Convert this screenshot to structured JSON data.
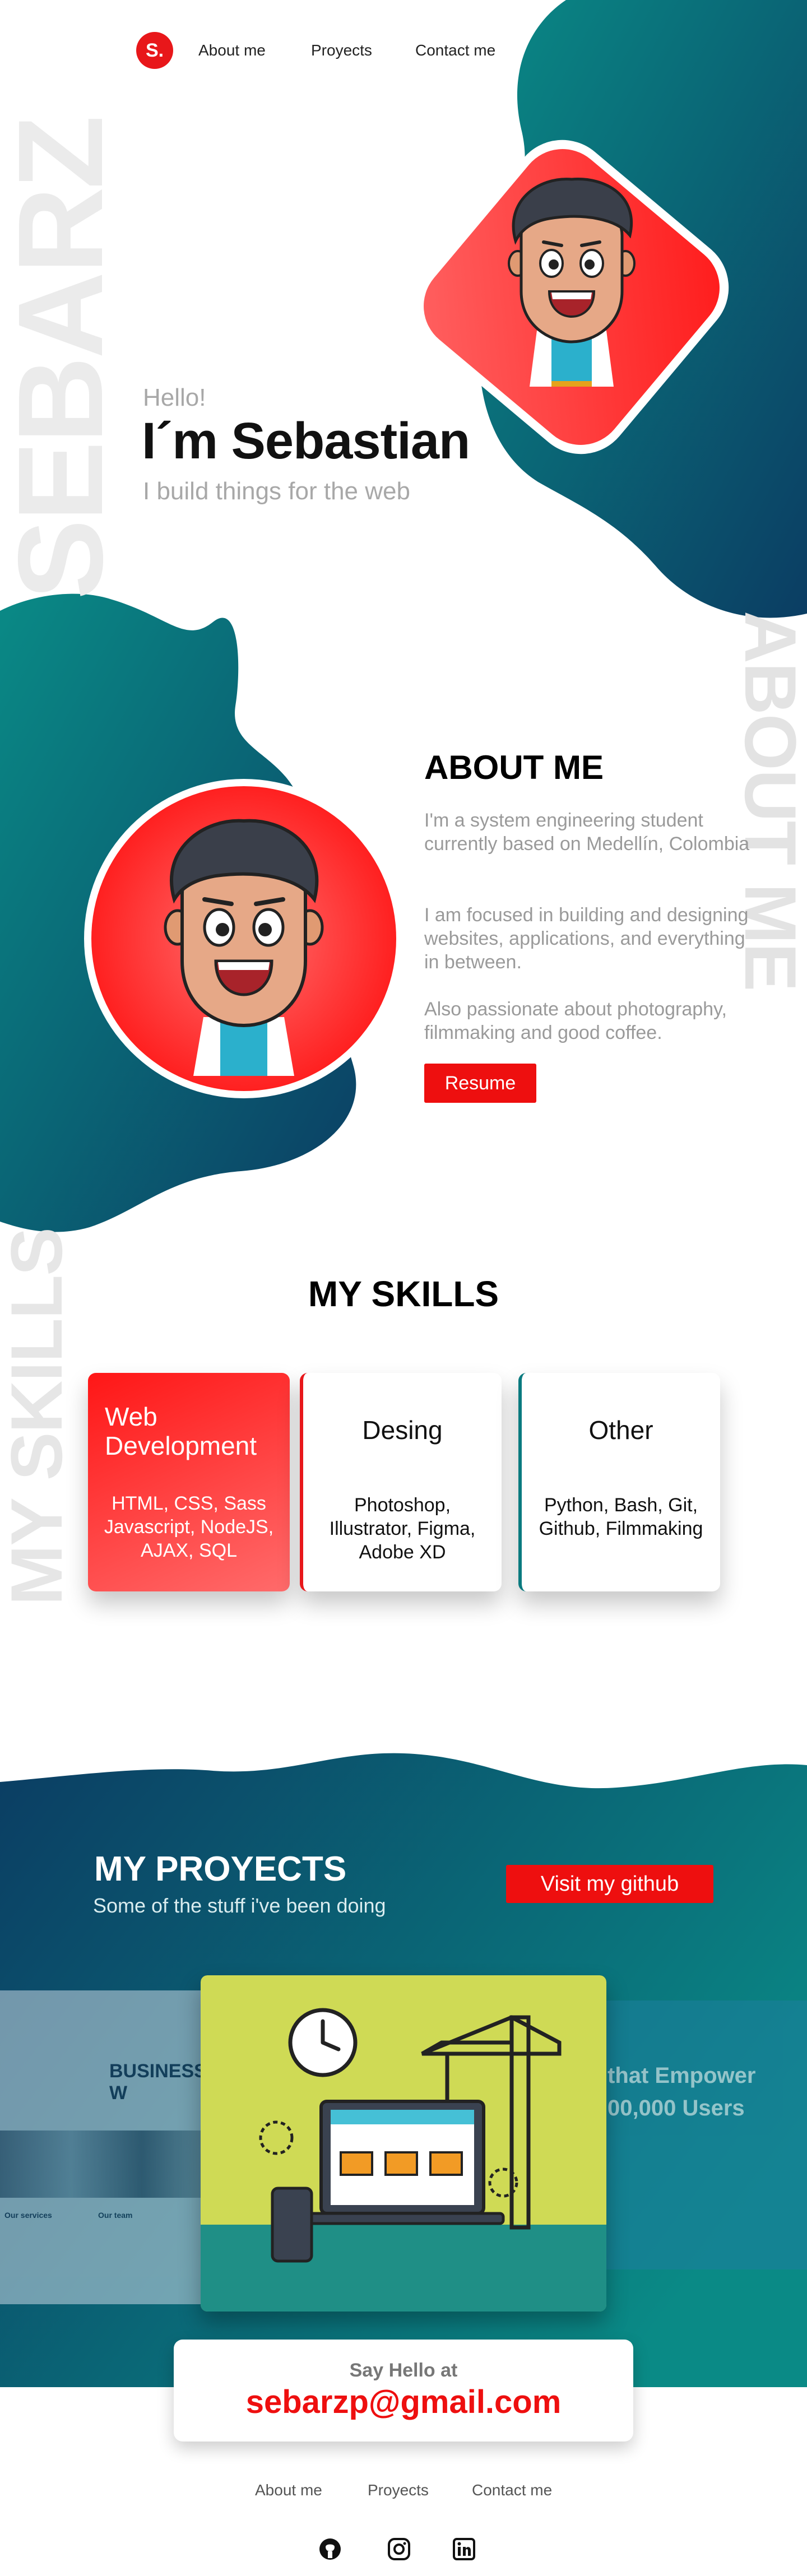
{
  "nav": {
    "logo": "S.",
    "about": "About me",
    "projects": "Proyects",
    "contact": "Contact me"
  },
  "side_words": {
    "brand": "SEBARZ",
    "about": "ABOUT ME",
    "skills": "MY SKILLS"
  },
  "hero": {
    "greeting": "Hello!",
    "name": "I´m Sebastian",
    "tagline": "I build things for the web"
  },
  "about": {
    "title": "ABOUT ME",
    "p1": "I'm a system engineering student currently based on Medellín, Colombia",
    "p2": "I am focused in building and designing websites, applications, and everything in between.",
    "p3": "Also passionate about photography, filmmaking and good coffee.",
    "resume": "Resume"
  },
  "skills": {
    "title": "MY SKILLS",
    "cards": [
      {
        "title": "Web Development",
        "items": "HTML, CSS, Sass Javascript, NodeJS, AJAX, SQL"
      },
      {
        "title": "Desing",
        "items": "Photoshop, Illustrator, Figma, Adobe XD"
      },
      {
        "title": "Other",
        "items": "Python, Bash, Git, Github, Filmmaking"
      }
    ]
  },
  "projects": {
    "title": "MY PROYECTS",
    "subtitle": "Some of the stuff i've been doing",
    "github": "Visit my github",
    "left_preview": {
      "heading": "BUSINESS W",
      "col1": "Our services",
      "col2": "Our team"
    },
    "right_preview": {
      "line1": "that Empower",
      "line2": "00,000 Users"
    }
  },
  "contact": {
    "label": "Say Hello at",
    "email": "sebarzp@gmail.com"
  },
  "footer": {
    "about": "About me",
    "projects": "Proyects",
    "contact": "Contact me"
  },
  "icons": [
    "github-icon",
    "instagram-icon",
    "linkedin-icon"
  ],
  "colors": {
    "accent": "#ee0f0f",
    "teal": "#0a7a7f",
    "navy": "#0b4766"
  }
}
